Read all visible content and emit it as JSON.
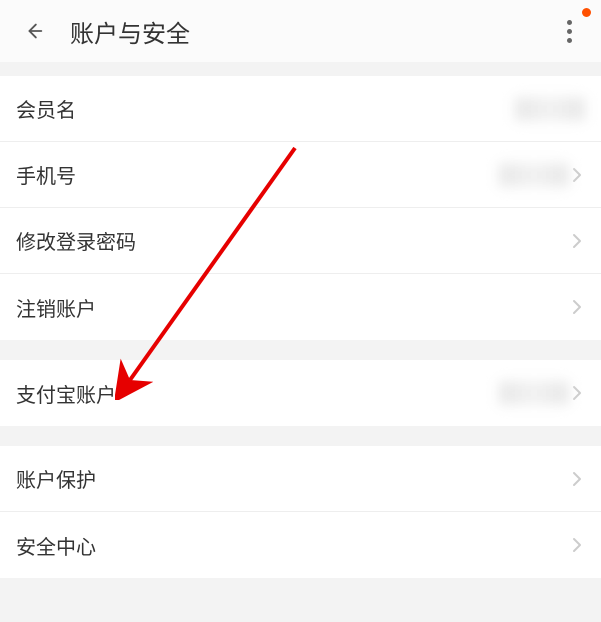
{
  "header": {
    "title": "账户与安全"
  },
  "rows": {
    "member_name": {
      "label": "会员名"
    },
    "phone": {
      "label": "手机号"
    },
    "change_password": {
      "label": "修改登录密码"
    },
    "delete_account": {
      "label": "注销账户"
    },
    "alipay_account": {
      "label": "支付宝账户"
    },
    "account_protection": {
      "label": "账户保护"
    },
    "security_center": {
      "label": "安全中心"
    }
  },
  "annotation": {
    "arrow_color": "#e60000"
  }
}
